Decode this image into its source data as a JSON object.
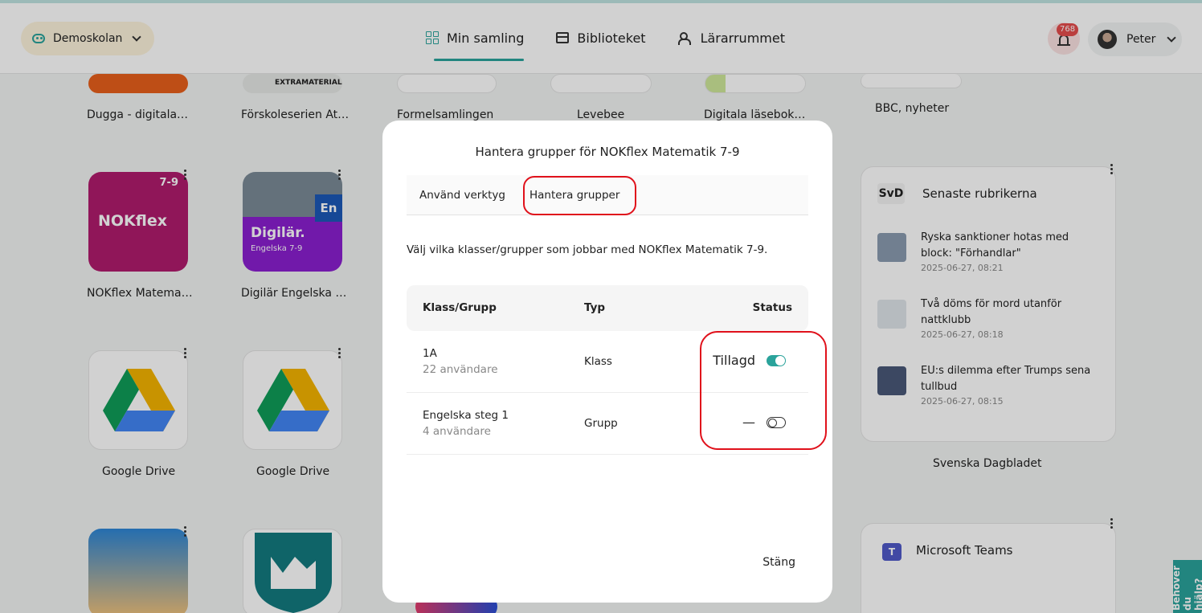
{
  "header": {
    "school": "Demoskolan",
    "nav": [
      {
        "label": "Min samling",
        "icon": "grid-icon"
      },
      {
        "label": "Biblioteket",
        "icon": "store-icon"
      },
      {
        "label": "Lärarrummet",
        "icon": "people-icon"
      }
    ],
    "notifications": "768",
    "user": "Peter"
  },
  "tiles": [
    {
      "label": "Dugga - digitala…"
    },
    {
      "label": "Förskoleserien At…",
      "tag": "EXTRAMATERIAL"
    },
    {
      "label": "Formelsamlingen"
    },
    {
      "label": "Levebee"
    },
    {
      "label": "Digitala läsebok…"
    },
    {
      "label": "BBC, nyheter"
    },
    {
      "label": "NOKflex Matema…",
      "logo": "NOKflex",
      "badge": "7-9"
    },
    {
      "label": "Digilär Engelska …",
      "logo": "Digilär.",
      "sub": "Engelska 7-9",
      "badge": "En"
    },
    {
      "label": "Google Drive"
    },
    {
      "label": "Google Drive"
    }
  ],
  "news": {
    "source": "SvD",
    "title": "Senaste rubrikerna",
    "items": [
      {
        "title": "Ryska sanktioner hotas med block: \"Förhandlar\"",
        "time": "2025-06-27, 08:21"
      },
      {
        "title": "Två döms för mord utanför nattklubb",
        "time": "2025-06-27, 08:18"
      },
      {
        "title": "EU:s dilemma efter Trumps sena tullbud",
        "time": "2025-06-27, 08:15"
      }
    ],
    "footer": "Svenska Dagbladet"
  },
  "teams": {
    "title": "Microsoft Teams"
  },
  "help": "Behöver du hjälp?",
  "modal": {
    "title": "Hantera grupper för NOKflex Matematik 7-9",
    "tabs": [
      "Använd verktyg",
      "Hantera grupper"
    ],
    "intro": "Välj vilka klasser/grupper som jobbar med NOKflex Matematik 7-9.",
    "columns": [
      "Klass/Grupp",
      "Typ",
      "Status"
    ],
    "rows": [
      {
        "name": "1A",
        "users": "22 användare",
        "type": "Klass",
        "status": "Tillagd",
        "enabled": true
      },
      {
        "name": "Engelska steg 1",
        "users": "4 användare",
        "type": "Grupp",
        "status": "—",
        "enabled": false
      }
    ],
    "close": "Stäng"
  },
  "colors": {
    "accent": "#2aa39b",
    "highlight": "#e0111b"
  }
}
